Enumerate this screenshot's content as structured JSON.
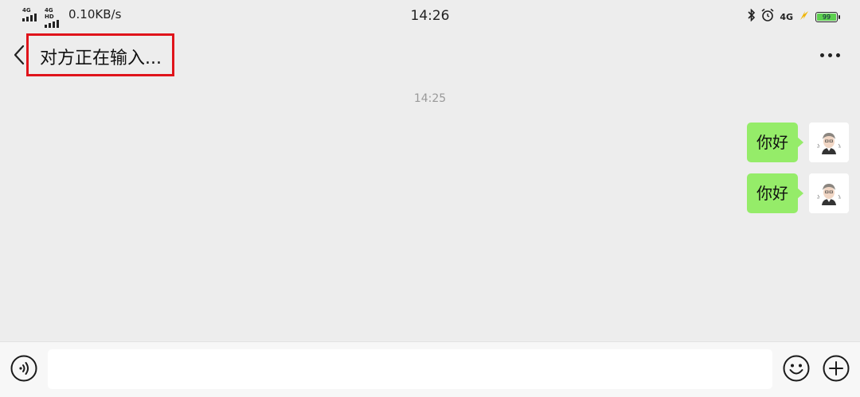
{
  "status_bar": {
    "signal_1_label": "4G",
    "signal_2_label": "4G HD",
    "net_speed": "0.10KB/s",
    "time": "14:26",
    "net_type_right": "4G",
    "battery_level": "99",
    "icons": [
      "bluetooth-icon",
      "alarm-icon",
      "signal-4g-icon",
      "charging-bolt-icon",
      "battery-icon"
    ]
  },
  "nav": {
    "title": "对方正在输入...",
    "highlight_color": "#e0141b"
  },
  "chat": {
    "timestamp": "14:25",
    "messages": [
      {
        "text": "你好",
        "side": "right"
      },
      {
        "text": "你好",
        "side": "right"
      }
    ],
    "bubble_color": "#95ec69"
  },
  "input_bar": {
    "value": "",
    "icons": [
      "voice-icon",
      "emoji-icon",
      "plus-icon"
    ]
  }
}
